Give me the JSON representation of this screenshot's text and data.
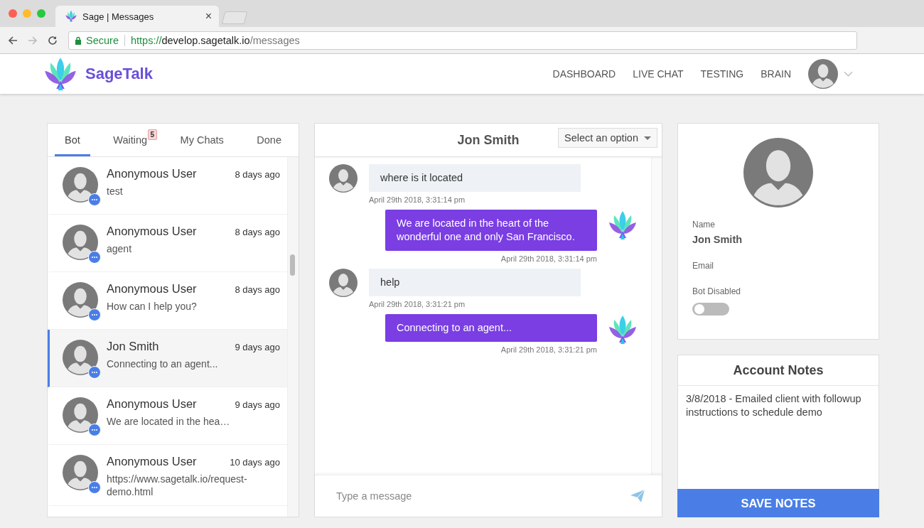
{
  "browser": {
    "tab_title": "Sage | Messages",
    "tab_close": "×",
    "address": {
      "secure_label": "Secure",
      "scheme": "https://",
      "host": "develop.sagetalk.io",
      "path": "/messages"
    }
  },
  "header": {
    "brand": "SageTalk",
    "nav": [
      {
        "label": "DASHBOARD"
      },
      {
        "label": "LIVE CHAT"
      },
      {
        "label": "TESTING"
      },
      {
        "label": "BRAIN"
      }
    ]
  },
  "chat_list": {
    "tabs": [
      {
        "label": "Bot",
        "selected": true
      },
      {
        "label": "Waiting",
        "selected": false,
        "badge": "5"
      },
      {
        "label": "My Chats",
        "selected": false
      },
      {
        "label": "Done",
        "selected": false
      }
    ],
    "conversations": [
      {
        "name": "Anonymous User",
        "time": "8 days ago",
        "preview": "test",
        "selected": false
      },
      {
        "name": "Anonymous User",
        "time": "8 days ago",
        "preview": "agent",
        "selected": false
      },
      {
        "name": "Anonymous User",
        "time": "8 days ago",
        "preview": "How can I help you?",
        "selected": false
      },
      {
        "name": "Jon Smith",
        "time": "9 days ago",
        "preview": "Connecting to an agent...",
        "selected": true
      },
      {
        "name": "Anonymous User",
        "time": "9 days ago",
        "preview": "We are located in the hea…",
        "selected": false
      },
      {
        "name": "Anonymous User",
        "time": "10 days ago",
        "preview": "https://www.sagetalk.io/request-demo.html",
        "selected": false
      }
    ]
  },
  "chat": {
    "title": "Jon Smith",
    "dropdown": {
      "placeholder": "Select an option"
    },
    "messages": [
      {
        "kind": "user",
        "text": "where is it located",
        "time": "April 29th 2018, 3:31:14 pm"
      },
      {
        "kind": "bot",
        "text": "We are located in the heart of the wonderful one and only San Francisco.",
        "time": "April 29th 2018, 3:31:14 pm"
      },
      {
        "kind": "user",
        "text": "help",
        "time": "April 29th 2018, 3:31:21 pm"
      },
      {
        "kind": "bot",
        "text": "Connecting to an agent...",
        "time": "April 29th 2018, 3:31:21 pm"
      }
    ],
    "input": {
      "placeholder": "Type a message"
    }
  },
  "profile": {
    "name_label": "Name",
    "name": "Jon Smith",
    "email_label": "Email",
    "bot_disabled_label": "Bot Disabled",
    "bot_disabled": {
      "on": false
    }
  },
  "notes": {
    "title": "Account Notes",
    "text": "3/8/2018 - Emailed client with followup instructions to schedule demo",
    "button": "SAVE NOTES"
  }
}
